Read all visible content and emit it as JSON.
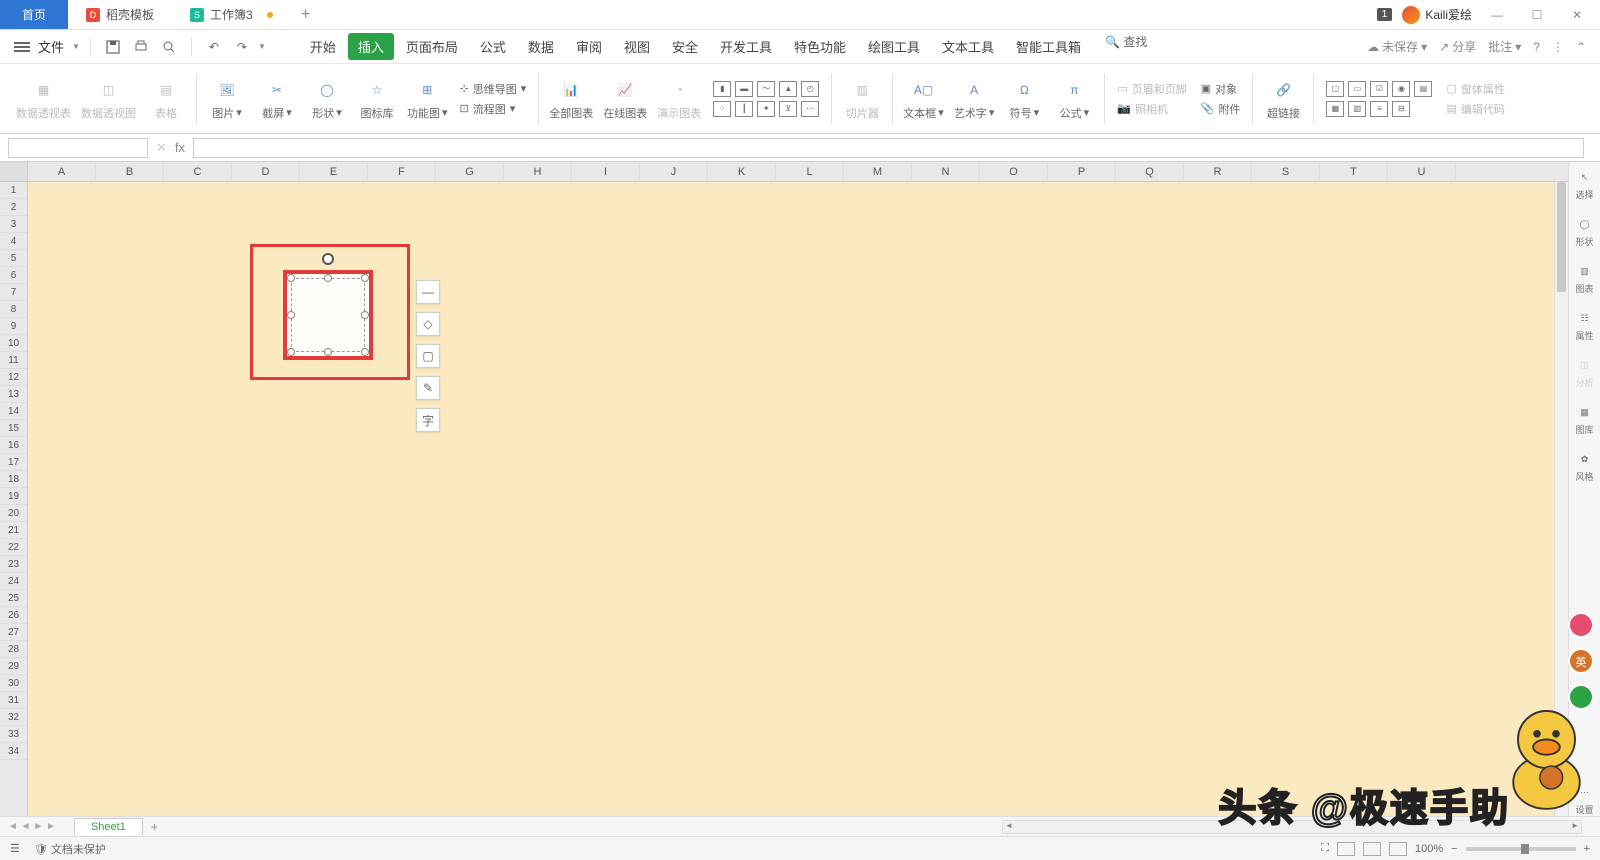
{
  "titlebar": {
    "tabs": [
      {
        "label": "首页",
        "kind": "home"
      },
      {
        "label": "稻壳模板",
        "kind": "docao"
      },
      {
        "label": "工作簿3",
        "kind": "sheet",
        "modified": true
      }
    ],
    "badge": "1",
    "username": "Kaili爱绘"
  },
  "menurow": {
    "file_label": "文件",
    "ribbon_tabs": [
      "开始",
      "插入",
      "页面布局",
      "公式",
      "数据",
      "审阅",
      "视图",
      "安全",
      "开发工具",
      "特色功能",
      "绘图工具",
      "文本工具",
      "智能工具箱"
    ],
    "active_tab": "插入",
    "search": "查找",
    "unsaved": "未保存",
    "share": "分享",
    "approve": "批注"
  },
  "ribbon": {
    "pivot_data": "数据透视表",
    "pivot_chart": "数据透视图",
    "table": "表格",
    "picture": "图片",
    "screenshot": "截屏",
    "shape": "形状",
    "icon_lib": "图标库",
    "function_chart": "功能图",
    "mindmap": "思维导图",
    "flowchart": "流程图",
    "all_charts": "全部图表",
    "online_chart": "在线图表",
    "demo_chart": "演示图表",
    "slicer": "切片器",
    "textbox": "文本框",
    "wordart": "艺术字",
    "symbol": "符号",
    "equation": "公式",
    "header_footer": "页眉和页脚",
    "object": "对象",
    "camera": "照相机",
    "attachment": "附件",
    "hyperlink": "超链接",
    "form_props": "窗体属性",
    "edit_code": "编辑代码"
  },
  "formula": {
    "namebox": "",
    "fx": "fx"
  },
  "columns": [
    "A",
    "B",
    "C",
    "D",
    "E",
    "F",
    "G",
    "H",
    "I",
    "J",
    "K",
    "L",
    "M",
    "N",
    "O",
    "P",
    "Q",
    "R",
    "S",
    "T",
    "U"
  ],
  "rows_count": 34,
  "sidepanel": {
    "select": "选择",
    "shape": "形状",
    "chart": "图表",
    "props": "属性",
    "analysis": "分析",
    "gallery": "图库",
    "style": "风格",
    "settings": "设置"
  },
  "sheettabs": {
    "sheet1": "Sheet1"
  },
  "statusbar": {
    "protect": "文档未保护",
    "zoom": "100%"
  },
  "watermark": "头条 @极速手助",
  "float_labels": {
    "text": "字"
  }
}
